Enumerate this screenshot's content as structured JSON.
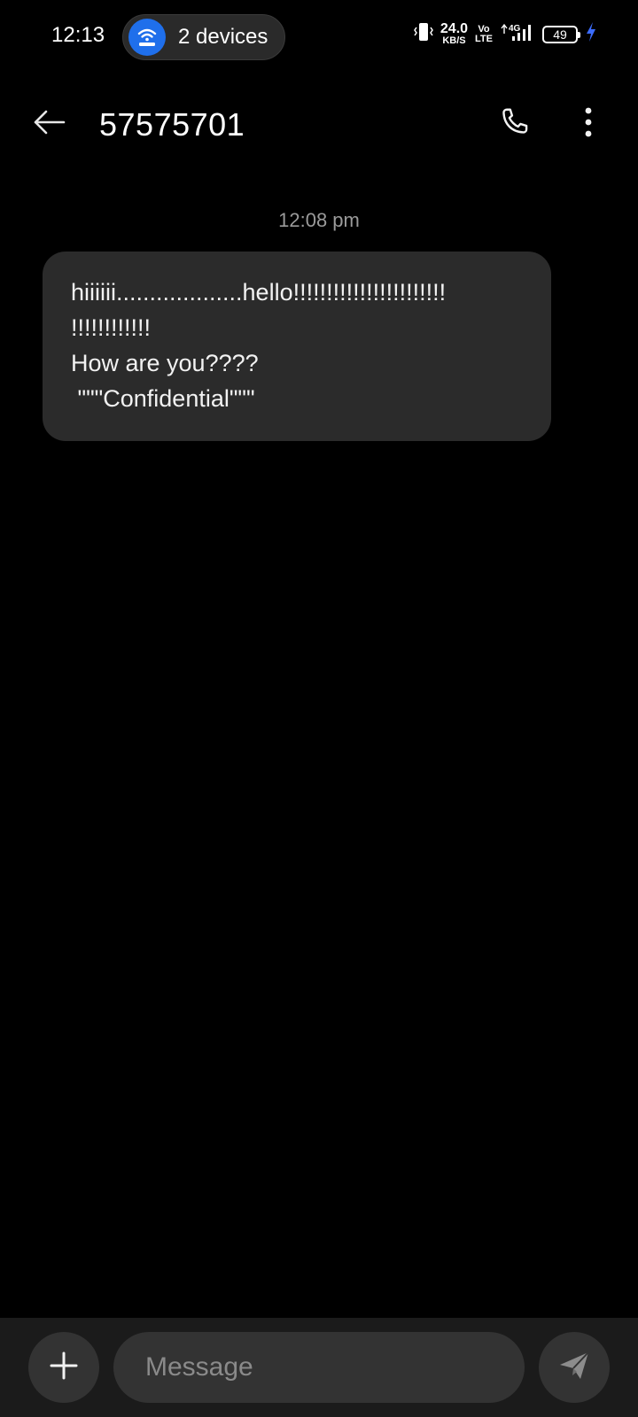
{
  "status_bar": {
    "time": "12:13",
    "hotspot": {
      "label": "2 devices",
      "icon": "wifi-router-icon",
      "color": "#1f6feb"
    },
    "net_speed": {
      "value": "24.0",
      "unit": "KB/S"
    },
    "volte": {
      "top": "Vo",
      "bottom": "LTE"
    },
    "network": "4G",
    "battery": {
      "level": "49",
      "charging": true,
      "charge_color": "#3b6cff"
    }
  },
  "header": {
    "title": "57575701",
    "back_icon": "arrow-left-icon",
    "call_icon": "phone-icon",
    "more_icon": "more-vertical-icon"
  },
  "conversation": {
    "timestamp": "12:08 pm",
    "messages": [
      {
        "direction": "incoming",
        "lines": [
          "hiiiiii...................hello!!!!!!!!!!!!!!!!!!!!!!!",
          "!!!!!!!!!!!!",
          "How are you????",
          " \"\"\"Confidential\"\"\""
        ]
      }
    ]
  },
  "composer": {
    "placeholder": "Message",
    "value": "",
    "add_icon": "plus-icon",
    "send_icon": "send-icon"
  },
  "colors": {
    "background": "#000000",
    "bubble": "#2b2b2b",
    "composer_bar": "#1b1b1b",
    "composer_controls": "#333333"
  }
}
